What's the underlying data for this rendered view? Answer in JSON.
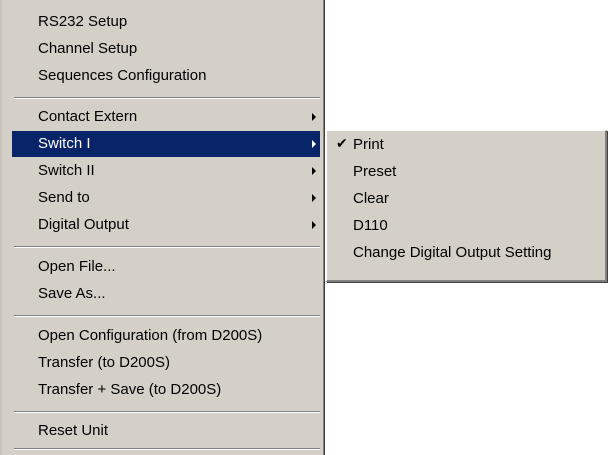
{
  "main_menu": {
    "group1": [
      "RS232 Setup",
      "Channel Setup",
      "Sequences Configuration"
    ],
    "group2": [
      {
        "label": "Contact Extern",
        "submenu": true
      },
      {
        "label": "Switch I",
        "submenu": true,
        "highlighted": true
      },
      {
        "label": "Switch II",
        "submenu": true
      },
      {
        "label": "Send to",
        "submenu": true
      },
      {
        "label": "Digital Output",
        "submenu": true
      }
    ],
    "group3": [
      "Open File...",
      "Save As..."
    ],
    "group4": [
      "Open Configuration (from D200S)",
      "Transfer (to D200S)",
      "Transfer + Save (to D200S)"
    ],
    "group5": [
      "Reset Unit"
    ]
  },
  "sub_menu": {
    "items": [
      "Print",
      "Preset",
      "Clear",
      "D110",
      "Change Digital Output Setting"
    ],
    "checked": "Print",
    "check_glyph": "✔"
  },
  "colors": {
    "menu_background": "#d4d0c8",
    "highlight": "#0a246a",
    "highlight_text": "#ffffff"
  }
}
